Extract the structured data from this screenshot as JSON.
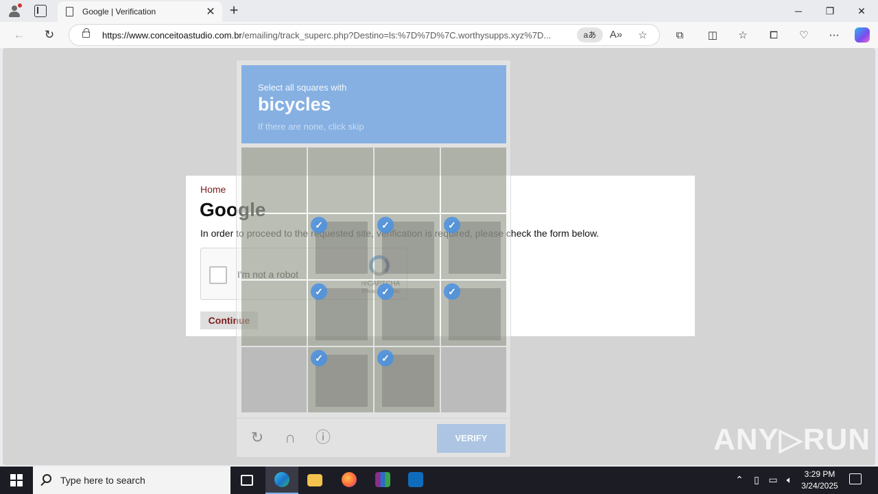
{
  "browser": {
    "tab_title": "Google | Verification",
    "tab_close": "✕",
    "new_tab": "+",
    "url_host": "https://www.conceitoastudio.com.br",
    "url_path": "/emailing/track_superc.php?Destino=ls:%7D%7D%7C.worthysupps.xyz%7D...",
    "read_aloud_chip": "aあ",
    "window_controls": {
      "minimize": "─",
      "restore": "❐",
      "close": "✕"
    }
  },
  "page": {
    "home_link": "Home",
    "brand": "Google",
    "notice": "In order to proceed to the requested site, verification is required, please check the form below.",
    "captcha": {
      "label": "I'm not a robot",
      "brand": "reCAPTCHA",
      "links": "Privacy - Terms"
    },
    "continue_label": "Continue"
  },
  "challenge": {
    "intro": "Select all squares with",
    "object": "bicycles",
    "skip_hint": "If there are none, click skip",
    "selected_tiles": [
      5,
      6,
      7,
      9,
      10,
      11,
      13,
      14
    ],
    "tick": "✓",
    "verify_label": "VERIFY"
  },
  "watermark": "ANY▷RUN",
  "taskbar": {
    "search_placeholder": "Type here to search",
    "time": "3:29 PM",
    "date": "3/24/2025",
    "accent_color": "#7fb2f0"
  },
  "icons": {
    "back": "back-arrow-icon",
    "refresh": "refresh-icon",
    "lock": "lock-icon",
    "favorite": "star-icon"
  }
}
